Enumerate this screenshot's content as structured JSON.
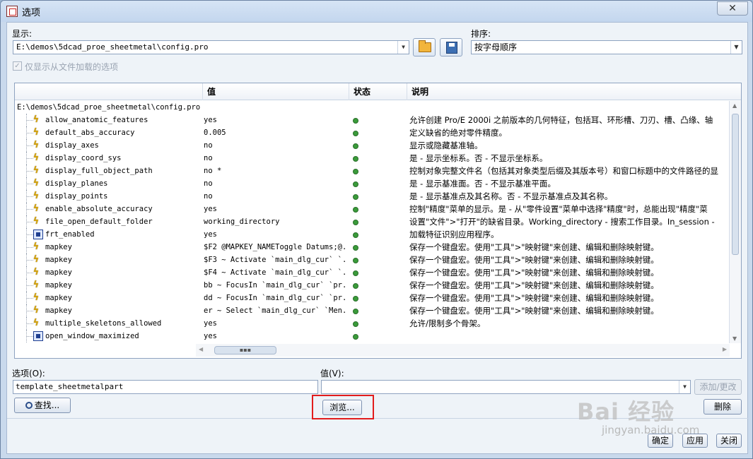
{
  "window": {
    "title": "选项",
    "close_glyph": "✕"
  },
  "display": {
    "label": "显示:",
    "value": "E:\\demos\\5dcad_proe_sheetmetal\\config.pro"
  },
  "sort": {
    "label": "排序:",
    "value": "按字母顺序"
  },
  "only_loaded": {
    "label": "仅显示从文件加载的选项",
    "checked": true
  },
  "table": {
    "headers": {
      "name": "",
      "value": "值",
      "status": "状态",
      "desc": "说明"
    },
    "root": "E:\\demos\\5dcad_proe_sheetmetal\\config.pro",
    "rows": [
      {
        "icon": "bolt",
        "name": "allow_anatomic_features",
        "value": "yes",
        "desc": "允许创建 Pro/E 2000i 之前版本的几何特征，包括耳、环形槽、刀刃、槽、凸缘、轴"
      },
      {
        "icon": "bolt",
        "name": "default_abs_accuracy",
        "value": "0.005",
        "desc": "定义缺省的绝对零件精度。"
      },
      {
        "icon": "bolt",
        "name": "display_axes",
        "value": "no",
        "desc": "显示或隐藏基准轴。"
      },
      {
        "icon": "bolt",
        "name": "display_coord_sys",
        "value": "no",
        "desc": "是 - 显示坐标系。否 - 不显示坐标系。"
      },
      {
        "icon": "bolt",
        "name": "display_full_object_path",
        "value": "no *",
        "desc": "控制对象完整文件名（包括其对象类型后缀及其版本号）和窗口标题中的文件路径的显"
      },
      {
        "icon": "bolt",
        "name": "display_planes",
        "value": "no",
        "desc": "是 - 显示基准面。否 - 不显示基准平面。"
      },
      {
        "icon": "bolt",
        "name": "display_points",
        "value": "no",
        "desc": "是 - 显示基准点及其名称。否 - 不显示基准点及其名称。"
      },
      {
        "icon": "bolt",
        "name": "enable_absolute_accuracy",
        "value": "yes",
        "desc": "控制\"精度\"菜单的显示。是 - 从\"零件设置\"菜单中选择\"精度\"时，总能出现\"精度\"菜"
      },
      {
        "icon": "bolt",
        "name": "file_open_default_folder",
        "value": "working_directory",
        "desc": "设置\"文件\">\"打开\"的缺省目录。Working_directory - 搜索工作目录。In_session -"
      },
      {
        "icon": "box",
        "name": "frt_enabled",
        "value": "yes",
        "desc": "加载特征识别应用程序。"
      },
      {
        "icon": "bolt",
        "name": "mapkey",
        "value": "$F2 @MAPKEY_NAMEToggle Datums;@...",
        "desc": "保存一个键盘宏。使用\"工具\">\"映射键\"来创建、编辑和删除映射键。"
      },
      {
        "icon": "bolt",
        "name": "mapkey",
        "value": "$F3 ~ Activate `main_dlg_cur` `...",
        "desc": "保存一个键盘宏。使用\"工具\">\"映射键\"来创建、编辑和删除映射键。"
      },
      {
        "icon": "bolt",
        "name": "mapkey",
        "value": "$F4 ~ Activate `main_dlg_cur` `...",
        "desc": "保存一个键盘宏。使用\"工具\">\"映射键\"来创建、编辑和删除映射键。"
      },
      {
        "icon": "bolt",
        "name": "mapkey",
        "value": "bb ~ FocusIn `main_dlg_cur` `pr...",
        "desc": "保存一个键盘宏。使用\"工具\">\"映射键\"来创建、编辑和删除映射键。"
      },
      {
        "icon": "bolt",
        "name": "mapkey",
        "value": "dd ~ FocusIn `main_dlg_cur` `pr...",
        "desc": "保存一个键盘宏。使用\"工具\">\"映射键\"来创建、编辑和删除映射键。"
      },
      {
        "icon": "bolt",
        "name": "mapkey",
        "value": "er ~ Select `main_dlg_cur` `Men...",
        "desc": "保存一个键盘宏。使用\"工具\">\"映射键\"来创建、编辑和删除映射键。"
      },
      {
        "icon": "bolt",
        "name": "multiple_skeletons_allowed",
        "value": "yes",
        "desc": "允许/限制多个骨架。"
      },
      {
        "icon": "box",
        "name": "open_window_maximized",
        "value": "yes",
        "desc": ""
      }
    ],
    "status_color": "#3a9b3a"
  },
  "option": {
    "label": "选项(O):",
    "value": "template_sheetmetalpart"
  },
  "value": {
    "label": "值(V):",
    "value": ""
  },
  "buttons": {
    "add_change": "添加/更改",
    "find": "查找...",
    "browse": "浏览...",
    "delete": "删除",
    "ok": "确定",
    "apply": "应用",
    "close": "关闭"
  },
  "watermark": {
    "text": "Bai 经验",
    "sub": "jingyan.baidu.com"
  },
  "accent_highlight": "#e21c1c"
}
